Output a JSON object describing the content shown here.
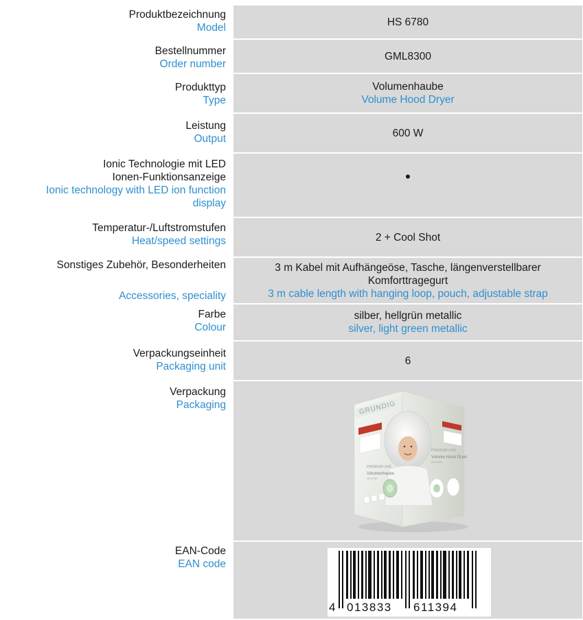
{
  "specs": {
    "model": {
      "label_de": "Produktbezeichnung",
      "label_en": "Model",
      "value": "HS 6780"
    },
    "order": {
      "label_de": "Bestellnummer",
      "label_en": "Order number",
      "value": "GML8300"
    },
    "type": {
      "label_de": "Produkttyp",
      "label_en": "Type",
      "value_de": "Volumenhaube",
      "value_en": "Volume Hood Dryer"
    },
    "output": {
      "label_de": "Leistung",
      "label_en": "Output",
      "value": "600 W"
    },
    "ionic": {
      "label_de_1": "Ionic Technologie mit LED",
      "label_de_2": "Ionen-Funktionsanzeige",
      "label_en_1": "Ionic technology with LED ion function",
      "label_en_2": "display",
      "value": "•"
    },
    "heat": {
      "label_de": "Temperatur-/Luftstromstufen",
      "label_en": "Heat/speed settings",
      "value": "2 + Cool Shot"
    },
    "accessories": {
      "label_de": "Sonstiges Zubehör, Besonderheiten",
      "label_en": "Accessories, speciality",
      "value_de_1": "3 m Kabel mit Aufhängeöse, Tasche, längenverstellbarer",
      "value_de_2": "Komforttragegurt",
      "value_en": "3 m cable length with hanging loop, pouch, adjustable strap"
    },
    "colour": {
      "label_de": "Farbe",
      "label_en": "Colour",
      "value_de": "silber, hellgrün metallic",
      "value_en": "silver, light green metallic"
    },
    "packaging_unit": {
      "label_de": "Verpackungseinheit",
      "label_en": "Packaging unit",
      "value": "6"
    },
    "packaging": {
      "label_de": "Verpackung",
      "label_en": "Packaging"
    },
    "ean": {
      "label_de": "EAN-Code",
      "label_en": "EAN code",
      "digits_1": "4",
      "digits_2": "013833",
      "digits_3": "611394"
    }
  },
  "box": {
    "brand": "GRUNDIG",
    "series": "PREMIUM LINE",
    "name_de": "Volumenhaube",
    "name_en": "Volume Hood Dryer",
    "model": "HS 6780"
  },
  "colors": {
    "accent": "#2f8fcf",
    "cell": "#d9d9d9",
    "text": "#1a1a1a"
  }
}
